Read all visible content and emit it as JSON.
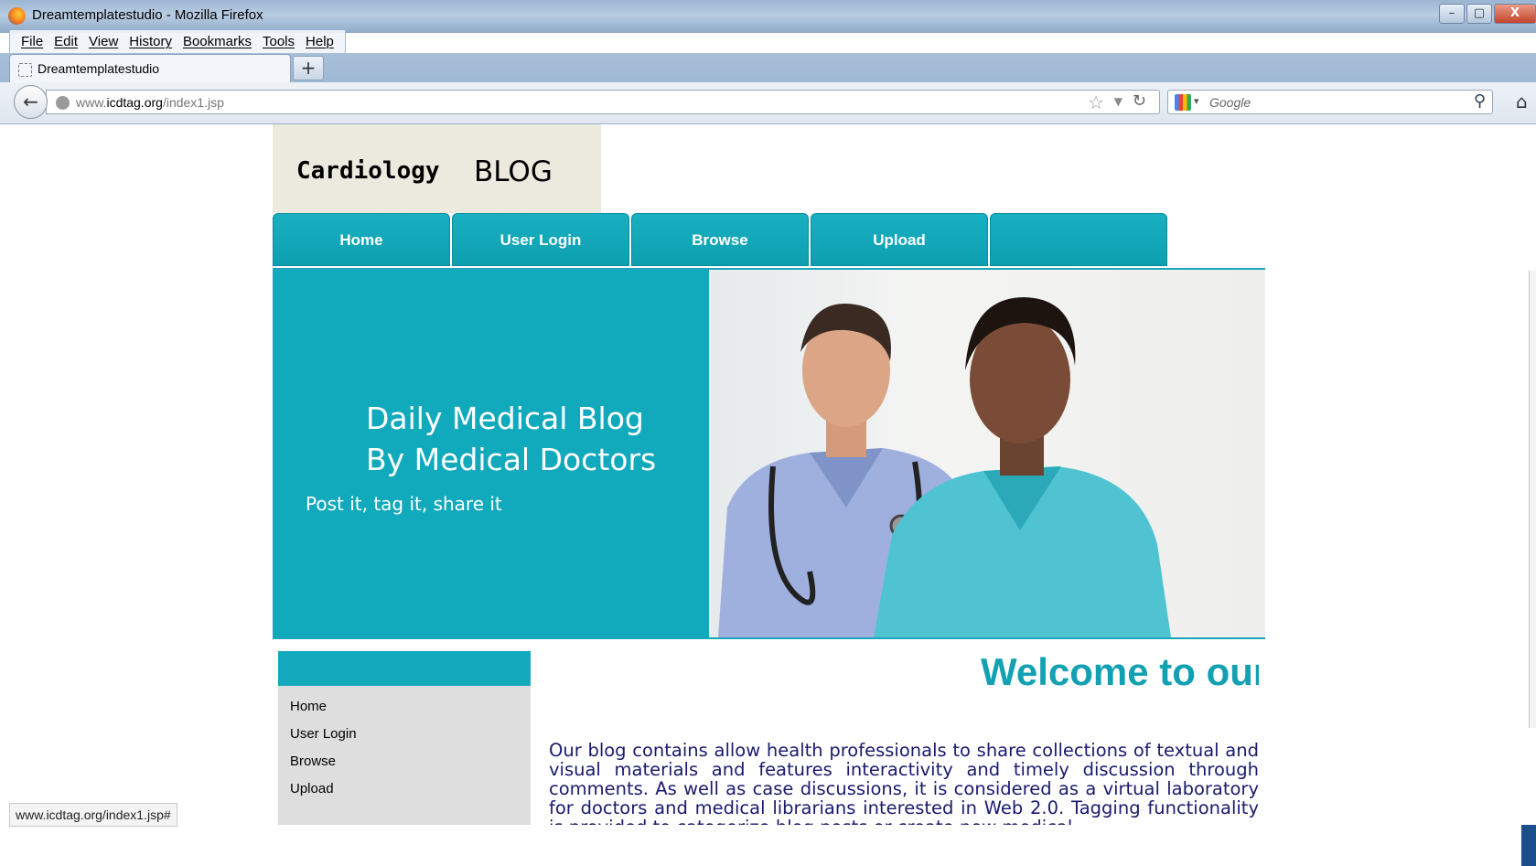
{
  "window": {
    "title": "Dreamtemplatestudio - Mozilla Firefox",
    "controls": [
      "–",
      "▢",
      "X"
    ]
  },
  "menubar": [
    "File",
    "Edit",
    "View",
    "History",
    "Bookmarks",
    "Tools",
    "Help"
  ],
  "tab": {
    "label": "Dreamtemplatestudio",
    "new_tab": "+"
  },
  "navbar": {
    "url_prefix": "www.",
    "url_domain": "icdtag.org",
    "url_path": "/index1.jsp",
    "search_placeholder": "Google"
  },
  "site": {
    "logo_mono": "Cardiology",
    "logo_word": "BLOG",
    "nav": [
      "Home",
      "User Login",
      "Browse",
      "Upload",
      ""
    ],
    "hero_line1": "Daily Medical Blog",
    "hero_line2": "By Medical Doctors",
    "hero_sub": "Post it, tag it, share it",
    "sidebar": [
      "Home",
      "User Login",
      "Browse",
      "Upload"
    ],
    "welcome": "Welcome to our",
    "blurb": "Our blog contains allow health professionals to share collections of textual and visual materials and features  interactivity and timely discussion through comments. As well as case discussions, it is considered as a virtual laboratory for doctors and medical librarians interested in Web 2.0. Tagging functionality is provided to categorize  blog posts or create new medical"
  },
  "status": "www.icdtag.org/index1.jsp#",
  "colors": {
    "accent": "#11a9bc",
    "blurb_text": "#1a1a6e",
    "welcome_text": "#12a0b3"
  }
}
